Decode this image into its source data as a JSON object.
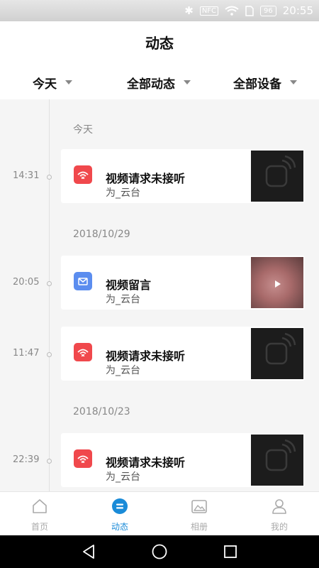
{
  "status_bar": {
    "battery": "96",
    "time": "20:55",
    "nfc": "NFC",
    "icons": [
      "bluetooth-icon",
      "nfc-icon",
      "wifi-icon",
      "sim-icon",
      "battery-icon"
    ]
  },
  "header": {
    "title": "动态"
  },
  "filters": [
    {
      "label": "今天"
    },
    {
      "label": "全部动态"
    },
    {
      "label": "全部设备"
    }
  ],
  "groups": [
    {
      "date": "今天",
      "events": [
        {
          "time": "14:31",
          "title": "视频请求未接听",
          "device": "为_云台",
          "type": "missed-call",
          "thumbnail": "camera-placeholder"
        }
      ]
    },
    {
      "date": "2018/10/29",
      "events": [
        {
          "time": "20:05",
          "title": "视频留言",
          "device": "为_云台",
          "type": "video-message",
          "thumbnail": "video-frame"
        },
        {
          "time": "11:47",
          "title": "视频请求未接听",
          "device": "为_云台",
          "type": "missed-call",
          "thumbnail": "camera-placeholder"
        }
      ]
    },
    {
      "date": "2018/10/23",
      "events": [
        {
          "time": "22:39",
          "title": "视频请求未接听",
          "device": "为_云台",
          "type": "missed-call",
          "thumbnail": "camera-placeholder"
        }
      ]
    }
  ],
  "tabs": [
    {
      "label": "首页",
      "icon": "home-icon",
      "active": false
    },
    {
      "label": "动态",
      "icon": "activity-icon",
      "active": true
    },
    {
      "label": "相册",
      "icon": "album-icon",
      "active": false
    },
    {
      "label": "我的",
      "icon": "profile-icon",
      "active": false
    }
  ],
  "colors": {
    "accent": "#1a8bd8",
    "missed_call": "#f0484c",
    "video_message": "#5b8def",
    "tab_inactive": "#aaaaaa"
  }
}
